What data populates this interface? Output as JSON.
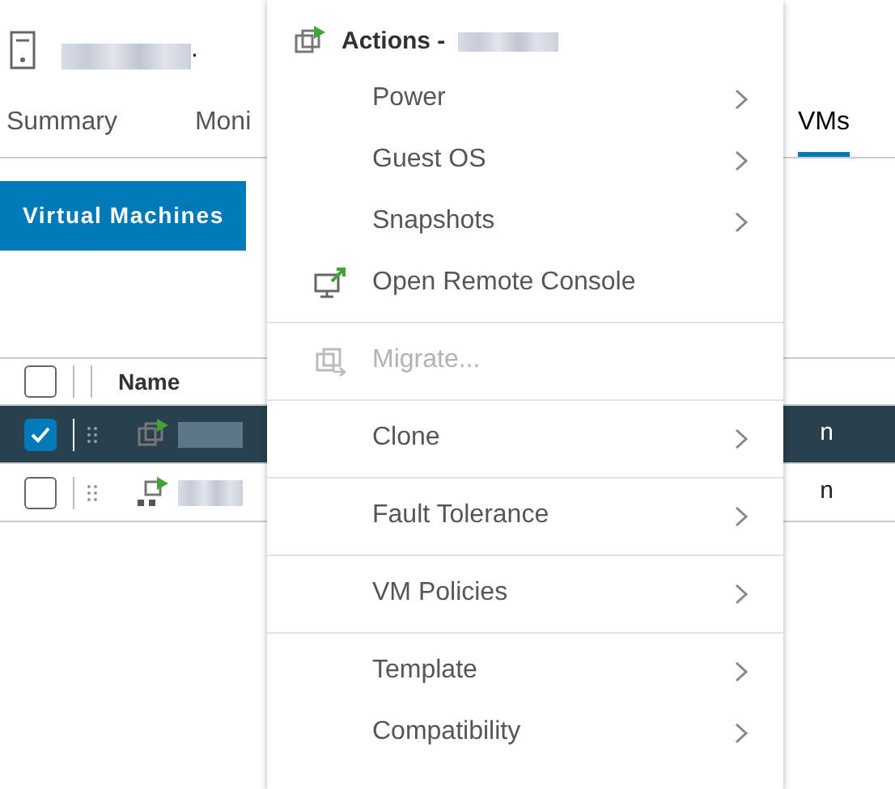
{
  "host": {
    "name_tail": "."
  },
  "tabs": [
    {
      "label": "Summary",
      "selected": false
    },
    {
      "label": "Moni",
      "selected": false
    },
    {
      "label": "VMs",
      "selected": true
    }
  ],
  "subtab": {
    "label": "Virtual Machines"
  },
  "table": {
    "columns": [
      {
        "label": "Name"
      }
    ],
    "header_checked": false,
    "rows": [
      {
        "selected": true,
        "cell": "n",
        "kind": "vm"
      },
      {
        "selected": false,
        "cell": "n",
        "kind": "template"
      }
    ]
  },
  "menu": {
    "title": "Actions -",
    "items": [
      {
        "label": "Power",
        "kind": "submenu",
        "disabled": false,
        "divider_before": false
      },
      {
        "label": "Guest OS",
        "kind": "submenu",
        "disabled": false,
        "divider_before": false
      },
      {
        "label": "Snapshots",
        "kind": "submenu",
        "disabled": false,
        "divider_before": false
      },
      {
        "label": "Open Remote Console",
        "kind": "console",
        "disabled": false,
        "divider_before": false
      },
      {
        "label": "Migrate...",
        "kind": "migrate",
        "disabled": true,
        "divider_before": true
      },
      {
        "label": "Clone",
        "kind": "submenu",
        "disabled": false,
        "divider_before": true
      },
      {
        "label": "Fault Tolerance",
        "kind": "submenu",
        "disabled": false,
        "divider_before": true
      },
      {
        "label": "VM Policies",
        "kind": "submenu",
        "disabled": false,
        "divider_before": true
      },
      {
        "label": "Template",
        "kind": "submenu",
        "disabled": false,
        "divider_before": true
      },
      {
        "label": "Compatibility",
        "kind": "submenu",
        "disabled": false,
        "divider_before": false
      }
    ]
  }
}
